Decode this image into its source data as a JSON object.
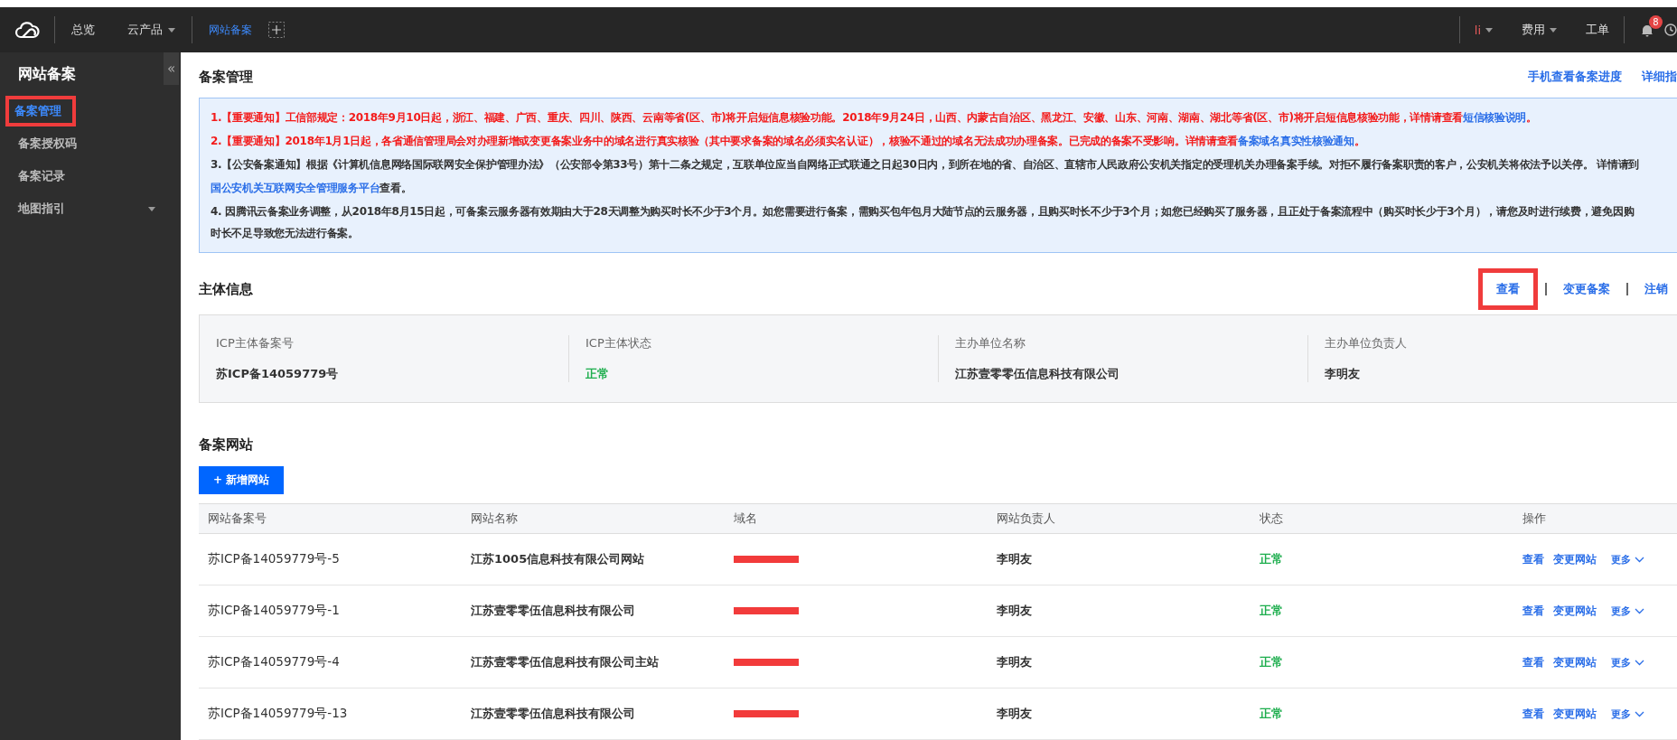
{
  "topbar": {
    "nav": [
      {
        "label": "总览",
        "dropdown": false,
        "selected": false
      },
      {
        "label": "云产品",
        "dropdown": true,
        "selected": false
      },
      {
        "label": "网站备案",
        "dropdown": false,
        "selected": true
      }
    ],
    "right": [
      {
        "label": "li",
        "dropdown": true
      },
      {
        "label": "费用",
        "dropdown": true
      },
      {
        "label": "工单",
        "dropdown": false
      }
    ],
    "notification_count": "8"
  },
  "sidebar": {
    "title": "网站备案",
    "collapse": "«",
    "items": [
      {
        "label": "备案管理",
        "selected": true,
        "highlighted": true,
        "expandable": false
      },
      {
        "label": "备案授权码",
        "selected": false,
        "highlighted": false,
        "expandable": false
      },
      {
        "label": "备案记录",
        "selected": false,
        "highlighted": false,
        "expandable": false
      },
      {
        "label": "地图指引",
        "selected": false,
        "highlighted": false,
        "expandable": true
      }
    ]
  },
  "page": {
    "title": "备案管理",
    "links": [
      "手机查看备案进度",
      "详细指"
    ]
  },
  "notices": [
    {
      "kind": "important",
      "text": "1.【重要通知】工信部规定：2018年9月10日起，浙江、福建、广西、重庆、四川、陕西、云南等省(区、市)将开启短信息核验功能。2018年9月24日，山西、内蒙古自治区、黑龙江、安徽、山东、河南、湖南、湖北等省(区、市)将开启短信息核验功能，详情请查看",
      "link": "短信核验说明",
      "after": "。"
    },
    {
      "kind": "important",
      "text": "2.【重要通知】2018年1月1日起，各省通信管理局会对办理新增或变更备案业务中的域名进行真实核验（其中要求备案的域名必须实名认证），核验不通过的域名无法成功办理备案。已完成的备案不受影响。详情请查看",
      "link": "备案域名真实性核验通知",
      "after": "。"
    },
    {
      "kind": "normal",
      "text": "3.【公安备案通知】根据《计算机信息网络国际联网安全保护管理办法》（公安部令第33号）第十二条之规定，互联单位应当自网络正式联通之日起30日内，到所在地的省、自治区、直辖市人民政府公安机关指定的受理机关办理备案手续。对拒不履行备案职责的客户，公安机关将依法予以关停。 详情请到",
      "link": "国公安机关互联网安全管理服务平台",
      "after": "查看。"
    },
    {
      "kind": "normal",
      "text": "4. 因腾讯云备案业务调整，从2018年8月15日起，可备案云服务器有效期由大于28天调整为购买时长不少于3个月。如您需要进行备案，需购买包年包月大陆节点的云服务器，且购买时长不少于3个月；如您已经购买了服务器，且正处于备案流程中（购买时长少于3个月），请您及时进行续费，避免因购"
    },
    {
      "kind": "normal",
      "text": "时长不足导致您无法进行备案。"
    }
  ],
  "subject": {
    "title": "主体信息",
    "actions": [
      {
        "label": "查看",
        "highlighted": true
      },
      {
        "label": "变更备案",
        "highlighted": false
      },
      {
        "label": "注销",
        "highlighted": false
      }
    ],
    "fields": [
      {
        "label": "ICP主体备案号",
        "value": "苏ICP备14059779号",
        "kind": "plain"
      },
      {
        "label": "ICP主体状态",
        "value": "正常",
        "kind": "status"
      },
      {
        "label": "主办单位名称",
        "value": "江苏壹零零伍信息科技有限公司",
        "kind": "plain"
      },
      {
        "label": "主办单位负责人",
        "value": "李明友",
        "kind": "plain"
      }
    ]
  },
  "sites": {
    "title": "备案网站",
    "add_button": "+ 新增网站",
    "columns": [
      "网站备案号",
      "网站名称",
      "域名",
      "网站负责人",
      "状态",
      "操作"
    ],
    "rows": [
      {
        "number": "苏ICP备14059779号-5",
        "name": "江苏1005信息科技有限公司网站",
        "domain_redacted": true,
        "owner": "李明友",
        "status": "正常",
        "actions": [
          "查看",
          "变更网站",
          "更多"
        ]
      },
      {
        "number": "苏ICP备14059779号-1",
        "name": "江苏壹零零伍信息科技有限公司",
        "domain_redacted": true,
        "owner": "李明友",
        "status": "正常",
        "actions": [
          "查看",
          "变更网站",
          "更多"
        ]
      },
      {
        "number": "苏ICP备14059779号-4",
        "name": "江苏壹零零伍信息科技有限公司主站",
        "domain_redacted": true,
        "owner": "李明友",
        "status": "正常",
        "actions": [
          "查看",
          "变更网站",
          "更多"
        ]
      },
      {
        "number": "苏ICP备14059779号-13",
        "name": "江苏壹零零伍信息科技有限公司",
        "domain_redacted": true,
        "owner": "李明友",
        "status": "正常",
        "actions": [
          "查看",
          "变更网站",
          "更多"
        ]
      }
    ]
  }
}
